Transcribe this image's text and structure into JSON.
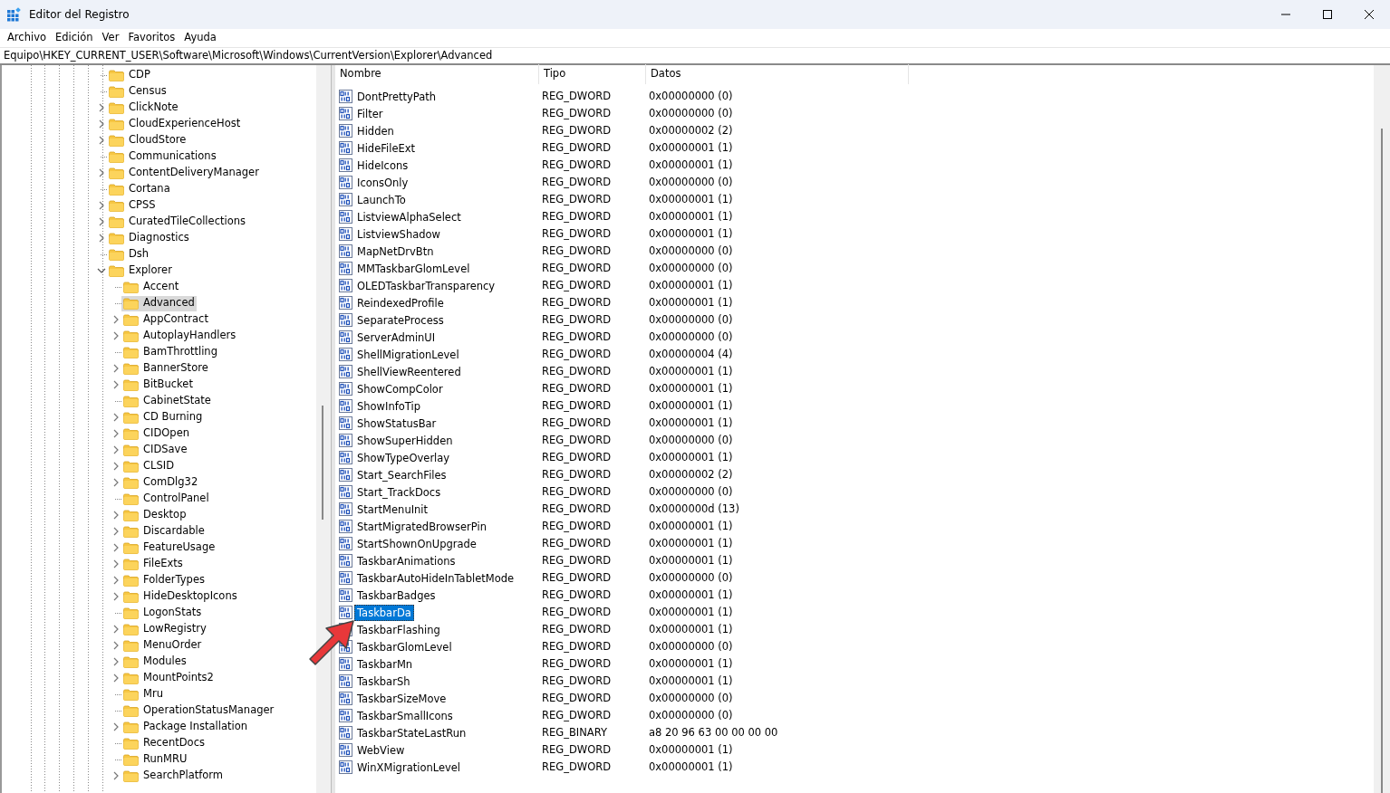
{
  "window": {
    "title": "Editor del Registro"
  },
  "menu": [
    "Archivo",
    "Edición",
    "Ver",
    "Favoritos",
    "Ayuda"
  ],
  "address": "Equipo\\HKEY_CURRENT_USER\\Software\\Microsoft\\Windows\\CurrentVersion\\Explorer\\Advanced",
  "tree": [
    {
      "label": "CDP",
      "selected": false
    },
    {
      "label": "Census",
      "selected": false
    },
    {
      "label": "ClickNote",
      "expanded": false,
      "selected": false
    },
    {
      "label": "CloudExperienceHost",
      "expanded": false,
      "selected": false
    },
    {
      "label": "CloudStore",
      "expanded": false,
      "selected": false
    },
    {
      "label": "Communications",
      "selected": false
    },
    {
      "label": "ContentDeliveryManager",
      "expanded": false,
      "selected": false
    },
    {
      "label": "Cortana",
      "selected": false
    },
    {
      "label": "CPSS",
      "expanded": false,
      "selected": false
    },
    {
      "label": "CuratedTileCollections",
      "expanded": false,
      "selected": false
    },
    {
      "label": "Diagnostics",
      "expanded": false,
      "selected": false
    },
    {
      "label": "Dsh",
      "selected": false
    },
    {
      "label": "Explorer",
      "expanded": true,
      "selected": false,
      "children": [
        {
          "label": "Accent",
          "selected": false
        },
        {
          "label": "Advanced",
          "selected": true
        },
        {
          "label": "AppContract",
          "expanded": false,
          "selected": false
        },
        {
          "label": "AutoplayHandlers",
          "expanded": false,
          "selected": false
        },
        {
          "label": "BamThrottling",
          "selected": false
        },
        {
          "label": "BannerStore",
          "expanded": false,
          "selected": false
        },
        {
          "label": "BitBucket",
          "expanded": false,
          "selected": false
        },
        {
          "label": "CabinetState",
          "selected": false
        },
        {
          "label": "CD Burning",
          "expanded": false,
          "selected": false
        },
        {
          "label": "CIDOpen",
          "expanded": false,
          "selected": false
        },
        {
          "label": "CIDSave",
          "expanded": false,
          "selected": false
        },
        {
          "label": "CLSID",
          "expanded": false,
          "selected": false
        },
        {
          "label": "ComDlg32",
          "expanded": false,
          "selected": false
        },
        {
          "label": "ControlPanel",
          "selected": false
        },
        {
          "label": "Desktop",
          "expanded": false,
          "selected": false
        },
        {
          "label": "Discardable",
          "expanded": false,
          "selected": false
        },
        {
          "label": "FeatureUsage",
          "expanded": false,
          "selected": false
        },
        {
          "label": "FileExts",
          "expanded": false,
          "selected": false
        },
        {
          "label": "FolderTypes",
          "expanded": false,
          "selected": false
        },
        {
          "label": "HideDesktopIcons",
          "expanded": false,
          "selected": false
        },
        {
          "label": "LogonStats",
          "selected": false
        },
        {
          "label": "LowRegistry",
          "expanded": false,
          "selected": false
        },
        {
          "label": "MenuOrder",
          "expanded": false,
          "selected": false
        },
        {
          "label": "Modules",
          "expanded": false,
          "selected": false
        },
        {
          "label": "MountPoints2",
          "expanded": false,
          "selected": false
        },
        {
          "label": "Mru",
          "selected": false
        },
        {
          "label": "OperationStatusManager",
          "selected": false
        },
        {
          "label": "Package Installation",
          "expanded": false,
          "selected": false
        },
        {
          "label": "RecentDocs",
          "selected": false
        },
        {
          "label": "RunMRU",
          "selected": false
        },
        {
          "label": "SearchPlatform",
          "expanded": false,
          "selected": false
        }
      ]
    }
  ],
  "table": {
    "columns": [
      "Nombre",
      "Tipo",
      "Datos"
    ],
    "rows": [
      {
        "name": "DontPrettyPath",
        "type": "REG_DWORD",
        "data": "0x00000000 (0)",
        "selected": false
      },
      {
        "name": "Filter",
        "type": "REG_DWORD",
        "data": "0x00000000 (0)",
        "selected": false
      },
      {
        "name": "Hidden",
        "type": "REG_DWORD",
        "data": "0x00000002 (2)",
        "selected": false
      },
      {
        "name": "HideFileExt",
        "type": "REG_DWORD",
        "data": "0x00000001 (1)",
        "selected": false
      },
      {
        "name": "HideIcons",
        "type": "REG_DWORD",
        "data": "0x00000001 (1)",
        "selected": false
      },
      {
        "name": "IconsOnly",
        "type": "REG_DWORD",
        "data": "0x00000000 (0)",
        "selected": false
      },
      {
        "name": "LaunchTo",
        "type": "REG_DWORD",
        "data": "0x00000001 (1)",
        "selected": false
      },
      {
        "name": "ListviewAlphaSelect",
        "type": "REG_DWORD",
        "data": "0x00000001 (1)",
        "selected": false
      },
      {
        "name": "ListviewShadow",
        "type": "REG_DWORD",
        "data": "0x00000001 (1)",
        "selected": false
      },
      {
        "name": "MapNetDrvBtn",
        "type": "REG_DWORD",
        "data": "0x00000000 (0)",
        "selected": false
      },
      {
        "name": "MMTaskbarGlomLevel",
        "type": "REG_DWORD",
        "data": "0x00000000 (0)",
        "selected": false
      },
      {
        "name": "OLEDTaskbarTransparency",
        "type": "REG_DWORD",
        "data": "0x00000001 (1)",
        "selected": false
      },
      {
        "name": "ReindexedProfile",
        "type": "REG_DWORD",
        "data": "0x00000001 (1)",
        "selected": false
      },
      {
        "name": "SeparateProcess",
        "type": "REG_DWORD",
        "data": "0x00000000 (0)",
        "selected": false
      },
      {
        "name": "ServerAdminUI",
        "type": "REG_DWORD",
        "data": "0x00000000 (0)",
        "selected": false
      },
      {
        "name": "ShellMigrationLevel",
        "type": "REG_DWORD",
        "data": "0x00000004 (4)",
        "selected": false
      },
      {
        "name": "ShellViewReentered",
        "type": "REG_DWORD",
        "data": "0x00000001 (1)",
        "selected": false
      },
      {
        "name": "ShowCompColor",
        "type": "REG_DWORD",
        "data": "0x00000001 (1)",
        "selected": false
      },
      {
        "name": "ShowInfoTip",
        "type": "REG_DWORD",
        "data": "0x00000001 (1)",
        "selected": false
      },
      {
        "name": "ShowStatusBar",
        "type": "REG_DWORD",
        "data": "0x00000001 (1)",
        "selected": false
      },
      {
        "name": "ShowSuperHidden",
        "type": "REG_DWORD",
        "data": "0x00000000 (0)",
        "selected": false
      },
      {
        "name": "ShowTypeOverlay",
        "type": "REG_DWORD",
        "data": "0x00000001 (1)",
        "selected": false
      },
      {
        "name": "Start_SearchFiles",
        "type": "REG_DWORD",
        "data": "0x00000002 (2)",
        "selected": false
      },
      {
        "name": "Start_TrackDocs",
        "type": "REG_DWORD",
        "data": "0x00000000 (0)",
        "selected": false
      },
      {
        "name": "StartMenuInit",
        "type": "REG_DWORD",
        "data": "0x0000000d (13)",
        "selected": false
      },
      {
        "name": "StartMigratedBrowserPin",
        "type": "REG_DWORD",
        "data": "0x00000001 (1)",
        "selected": false
      },
      {
        "name": "StartShownOnUpgrade",
        "type": "REG_DWORD",
        "data": "0x00000001 (1)",
        "selected": false
      },
      {
        "name": "TaskbarAnimations",
        "type": "REG_DWORD",
        "data": "0x00000001 (1)",
        "selected": false
      },
      {
        "name": "TaskbarAutoHideInTabletMode",
        "type": "REG_DWORD",
        "data": "0x00000000 (0)",
        "selected": false
      },
      {
        "name": "TaskbarBadges",
        "type": "REG_DWORD",
        "data": "0x00000001 (1)",
        "selected": false
      },
      {
        "name": "TaskbarDa",
        "type": "REG_DWORD",
        "data": "0x00000001 (1)",
        "selected": true
      },
      {
        "name": "TaskbarFlashing",
        "type": "REG_DWORD",
        "data": "0x00000001 (1)",
        "selected": false
      },
      {
        "name": "TaskbarGlomLevel",
        "type": "REG_DWORD",
        "data": "0x00000000 (0)",
        "selected": false
      },
      {
        "name": "TaskbarMn",
        "type": "REG_DWORD",
        "data": "0x00000001 (1)",
        "selected": false
      },
      {
        "name": "TaskbarSh",
        "type": "REG_DWORD",
        "data": "0x00000001 (1)",
        "selected": false
      },
      {
        "name": "TaskbarSizeMove",
        "type": "REG_DWORD",
        "data": "0x00000000 (0)",
        "selected": false
      },
      {
        "name": "TaskbarSmallIcons",
        "type": "REG_DWORD",
        "data": "0x00000000 (0)",
        "selected": false
      },
      {
        "name": "TaskbarStateLastRun",
        "type": "REG_BINARY",
        "data": "a8 20 96 63 00 00 00 00",
        "selected": false
      },
      {
        "name": "WebView",
        "type": "REG_DWORD",
        "data": "0x00000001 (1)",
        "selected": false
      },
      {
        "name": "WinXMigrationLevel",
        "type": "REG_DWORD",
        "data": "0x00000001 (1)",
        "selected": false
      }
    ]
  }
}
